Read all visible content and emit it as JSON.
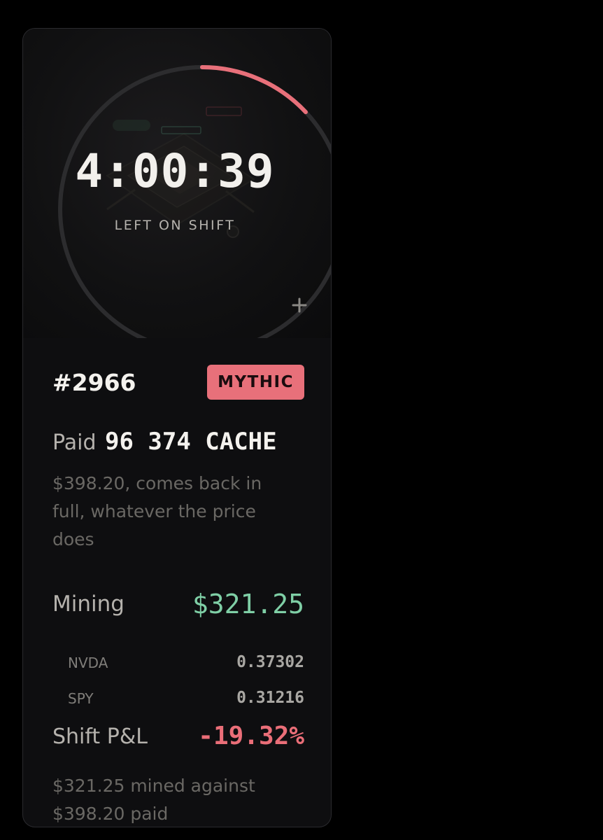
{
  "timer": {
    "time_left": "4:00:39",
    "caption": "LEFT ON SHIFT",
    "progress_fraction": 0.13
  },
  "card": {
    "token_id": "#2966",
    "rarity": "MYTHIC",
    "paid": {
      "label": "Paid",
      "amount": "96 374 CACHE",
      "note": "$398.20, comes back in full, whatever the price does"
    },
    "mining": {
      "label": "Mining",
      "value": "$321.25",
      "holdings": [
        {
          "ticker": "NVDA",
          "amount": "0.37302"
        },
        {
          "ticker": "SPY",
          "amount": "0.31216"
        }
      ]
    },
    "pnl": {
      "label": "Shift P&L",
      "value": "-19.32%",
      "note": "$321.25 mined against $398.20 paid"
    }
  },
  "icons": {
    "expand": "plus-icon"
  },
  "colors": {
    "background": "#000000",
    "card": "#0e0e10",
    "accent_red": "#e8707a",
    "positive_green": "#7fcfa6",
    "ring_track": "#2c2c2e"
  }
}
